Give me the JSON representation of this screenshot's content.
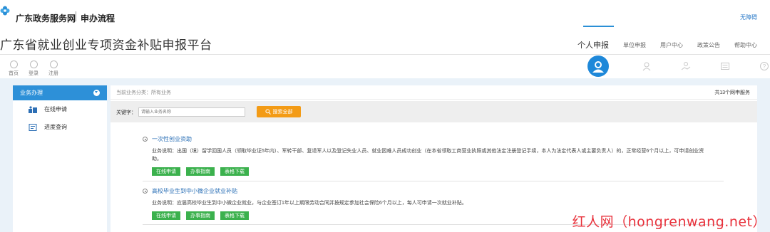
{
  "topbar": {
    "site_name": "广东政务服务网",
    "flow_name": "申办流程",
    "accessible_label": "无障碍"
  },
  "header": {
    "platform_title": "广东省就业创业专项资金补贴申报平台",
    "tabs": [
      {
        "label": "个人申报",
        "active": true
      },
      {
        "label": "单位申报",
        "active": false
      },
      {
        "label": "用户中心",
        "active": false
      },
      {
        "label": "政策公告",
        "active": false
      },
      {
        "label": "帮助中心",
        "active": false
      }
    ]
  },
  "mini_nav": [
    {
      "label": "首页",
      "icon": "home-icon"
    },
    {
      "label": "登录",
      "icon": "login-icon"
    },
    {
      "label": "注册",
      "icon": "register-icon"
    }
  ],
  "user_icons": [
    "person-avatar-icon",
    "user-icon",
    "handshake-icon",
    "list-icon",
    "help-icon"
  ],
  "sidebar": {
    "title": "业务办理",
    "items": [
      {
        "label": "在线申请",
        "icon": "apply-icon"
      },
      {
        "label": "进度查询",
        "icon": "query-icon"
      }
    ]
  },
  "main": {
    "crumb": "当前业务分类：所有业务",
    "count": "共13个网申服务",
    "search": {
      "label": "关键字：",
      "placeholder": "请输入业务名称",
      "button": "搜索全部"
    },
    "services": [
      {
        "title": "一次性创业资助",
        "desc": "业务说明：出国（境）留学回国人员（领取毕业证5年内）、军转干部、复退军人以及登记失业人员、就业困难人员成功创业（在本省领取工商营业执照或其他法定注册登记手续，本人为法定代表人或主要负责人）的，正常经营6个月以上，可申请创业资助。",
        "buttons": [
          "在线申请",
          "办事指南",
          "表格下载"
        ]
      },
      {
        "title": "高校毕业生到中小微企业就业补贴",
        "desc": "业务说明：应届高校毕业生到中小微企业就业，与企业签订1年以上期限劳动合同并按规定参加社会保险6个月以上，每人可申请一次就业补贴。",
        "buttons": [
          "在线申请",
          "办事指南",
          "表格下载"
        ]
      }
    ]
  },
  "watermark": "红人网（hongrenwang.net）",
  "colors": {
    "accent_blue": "#2d90d8",
    "search_orange": "#f39b16",
    "action_green": "#3bb14d",
    "content_bg": "#eaf2f9",
    "watermark_red": "#e8323c"
  }
}
